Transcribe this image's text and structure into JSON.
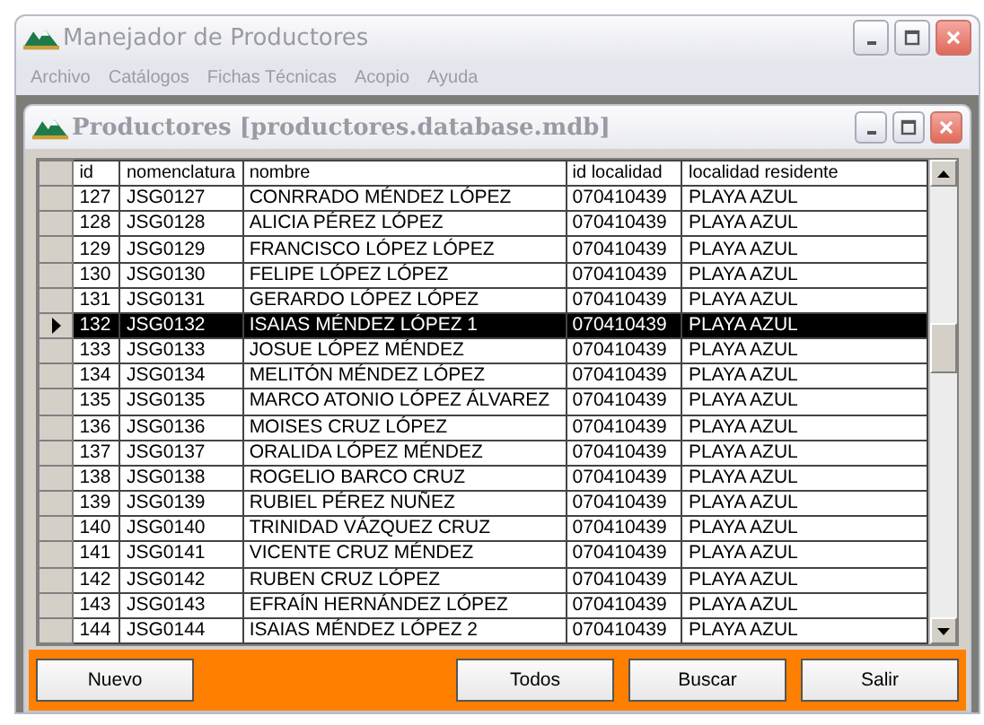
{
  "window": {
    "title": "Manejador de Productores"
  },
  "menu": [
    "Archivo",
    "Catálogos",
    "Fichas Técnicas",
    "Acopio",
    "Ayuda"
  ],
  "child_window": {
    "title": "Productores [productores.database.mdb]"
  },
  "table": {
    "columns": [
      "id",
      "nomenclatura",
      "nombre",
      "id localidad",
      "localidad residente"
    ],
    "rows": [
      {
        "cells": [
          "127",
          "JSG0127",
          "CONRRADO MÉNDEZ LÓPEZ",
          "070410439",
          "PLAYA AZUL"
        ],
        "selected": false
      },
      {
        "cells": [
          "128",
          "JSG0128",
          "ALICIA PÉREZ LÓPEZ",
          "070410439",
          "PLAYA AZUL"
        ],
        "selected": false
      },
      {
        "cells": [
          "129",
          "JSG0129",
          "FRANCISCO LÓPEZ LÓPEZ",
          "070410439",
          "PLAYA AZUL"
        ],
        "selected": false
      },
      {
        "cells": [
          "130",
          "JSG0130",
          "FELIPE LÓPEZ LÓPEZ",
          "070410439",
          "PLAYA AZUL"
        ],
        "selected": false
      },
      {
        "cells": [
          "131",
          "JSG0131",
          "GERARDO LÓPEZ LÓPEZ",
          "070410439",
          "PLAYA AZUL"
        ],
        "selected": false
      },
      {
        "cells": [
          "132",
          "JSG0132",
          "ISAIAS MÉNDEZ LÓPEZ 1",
          "070410439",
          "PLAYA AZUL"
        ],
        "selected": true
      },
      {
        "cells": [
          "133",
          "JSG0133",
          "JOSUE LÓPEZ MÉNDEZ",
          "070410439",
          "PLAYA AZUL"
        ],
        "selected": false
      },
      {
        "cells": [
          "134",
          "JSG0134",
          "MELITÓN MÉNDEZ LÓPEZ",
          "070410439",
          "PLAYA AZUL"
        ],
        "selected": false
      },
      {
        "cells": [
          "135",
          "JSG0135",
          "MARCO ATONIO LÓPEZ ÁLVAREZ",
          "070410439",
          "PLAYA AZUL"
        ],
        "selected": false
      },
      {
        "cells": [
          "136",
          "JSG0136",
          "MOISES CRUZ LÓPEZ",
          "070410439",
          "PLAYA AZUL"
        ],
        "selected": false
      },
      {
        "cells": [
          "137",
          "JSG0137",
          "ORALIDA LÓPEZ MÉNDEZ",
          "070410439",
          "PLAYA AZUL"
        ],
        "selected": false
      },
      {
        "cells": [
          "138",
          "JSG0138",
          "ROGELIO BARCO CRUZ",
          "070410439",
          "PLAYA AZUL"
        ],
        "selected": false
      },
      {
        "cells": [
          "139",
          "JSG0139",
          "RUBIEL PÉREZ NUÑEZ",
          "070410439",
          "PLAYA AZUL"
        ],
        "selected": false
      },
      {
        "cells": [
          "140",
          "JSG0140",
          "TRINIDAD VÁZQUEZ CRUZ",
          "070410439",
          "PLAYA AZUL"
        ],
        "selected": false
      },
      {
        "cells": [
          "141",
          "JSG0141",
          "VICENTE CRUZ MÉNDEZ",
          "070410439",
          "PLAYA AZUL"
        ],
        "selected": false
      },
      {
        "cells": [
          "142",
          "JSG0142",
          "RUBEN CRUZ LÓPEZ",
          "070410439",
          "PLAYA AZUL"
        ],
        "selected": false
      },
      {
        "cells": [
          "143",
          "JSG0143",
          "EFRAÍN HERNÁNDEZ LÓPEZ",
          "070410439",
          "PLAYA AZUL"
        ],
        "selected": false
      },
      {
        "cells": [
          "144",
          "JSG0144",
          "ISAIAS MÉNDEZ LÓPEZ 2",
          "070410439",
          "PLAYA AZUL"
        ],
        "selected": false
      }
    ]
  },
  "buttons": [
    "Nuevo",
    "Todos",
    "Buscar",
    "Salir"
  ]
}
